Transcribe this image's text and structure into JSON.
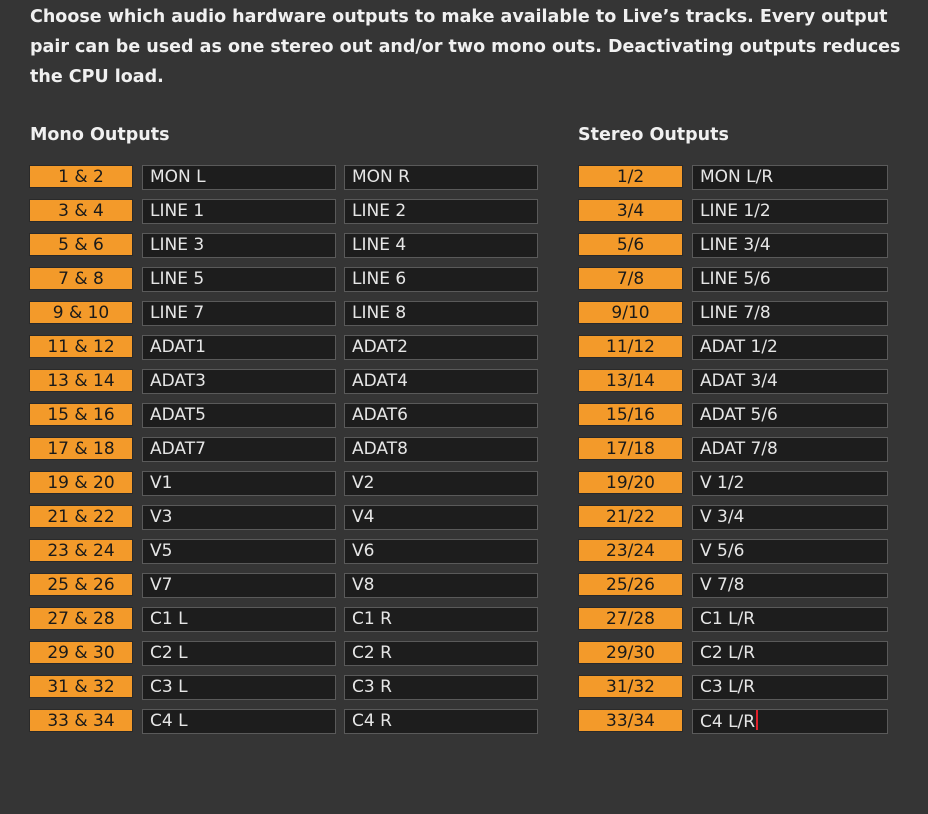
{
  "description": "Choose which audio hardware outputs to make available to Live’s tracks. Every output pair can be used as one stereo out and/or two mono outs.  Deactivating outputs reduces the CPU load.",
  "mono": {
    "title": "Mono Outputs",
    "rows": [
      {
        "pair": "1 & 2",
        "left": "MON L",
        "right": "MON R"
      },
      {
        "pair": "3 & 4",
        "left": "LINE 1",
        "right": "LINE 2"
      },
      {
        "pair": "5 & 6",
        "left": "LINE 3",
        "right": "LINE 4"
      },
      {
        "pair": "7 & 8",
        "left": "LINE 5",
        "right": "LINE 6"
      },
      {
        "pair": "9 & 10",
        "left": "LINE 7",
        "right": "LINE 8"
      },
      {
        "pair": "11 & 12",
        "left": "ADAT1",
        "right": "ADAT2"
      },
      {
        "pair": "13 & 14",
        "left": "ADAT3",
        "right": "ADAT4"
      },
      {
        "pair": "15 & 16",
        "left": "ADAT5",
        "right": "ADAT6"
      },
      {
        "pair": "17 & 18",
        "left": "ADAT7",
        "right": "ADAT8"
      },
      {
        "pair": "19 & 20",
        "left": "V1",
        "right": "V2"
      },
      {
        "pair": "21 & 22",
        "left": "V3",
        "right": "V4"
      },
      {
        "pair": "23 & 24",
        "left": "V5",
        "right": "V6"
      },
      {
        "pair": "25 & 26",
        "left": "V7",
        "right": "V8"
      },
      {
        "pair": "27 & 28",
        "left": "C1 L",
        "right": "C1 R"
      },
      {
        "pair": "29 & 30",
        "left": "C2 L",
        "right": "C2 R"
      },
      {
        "pair": "31 & 32",
        "left": "C3 L",
        "right": "C3 R"
      },
      {
        "pair": "33 & 34",
        "left": "C4 L",
        "right": "C4 R"
      }
    ]
  },
  "stereo": {
    "title": "Stereo Outputs",
    "rows": [
      {
        "pair": "1/2",
        "name": "MON L/R"
      },
      {
        "pair": "3/4",
        "name": "LINE 1/2"
      },
      {
        "pair": "5/6",
        "name": "LINE 3/4"
      },
      {
        "pair": "7/8",
        "name": "LINE 5/6"
      },
      {
        "pair": "9/10",
        "name": "LINE 7/8"
      },
      {
        "pair": "11/12",
        "name": "ADAT 1/2"
      },
      {
        "pair": "13/14",
        "name": "ADAT 3/4"
      },
      {
        "pair": "15/16",
        "name": "ADAT 5/6"
      },
      {
        "pair": "17/18",
        "name": "ADAT 7/8"
      },
      {
        "pair": "19/20",
        "name": "V 1/2"
      },
      {
        "pair": "21/22",
        "name": "V 3/4"
      },
      {
        "pair": "23/24",
        "name": "V 5/6"
      },
      {
        "pair": "25/26",
        "name": "V 7/8"
      },
      {
        "pair": "27/28",
        "name": "C1 L/R"
      },
      {
        "pair": "29/30",
        "name": "C2 L/R"
      },
      {
        "pair": "31/32",
        "name": "C3 L/R"
      },
      {
        "pair": "33/34",
        "name": "C4 L/R"
      }
    ],
    "editing_row": 16
  },
  "colors": {
    "background": "#353535",
    "active_toggle": "#f39a2a",
    "name_field": "#1d1d1d",
    "text_cursor": "#e0202a"
  }
}
